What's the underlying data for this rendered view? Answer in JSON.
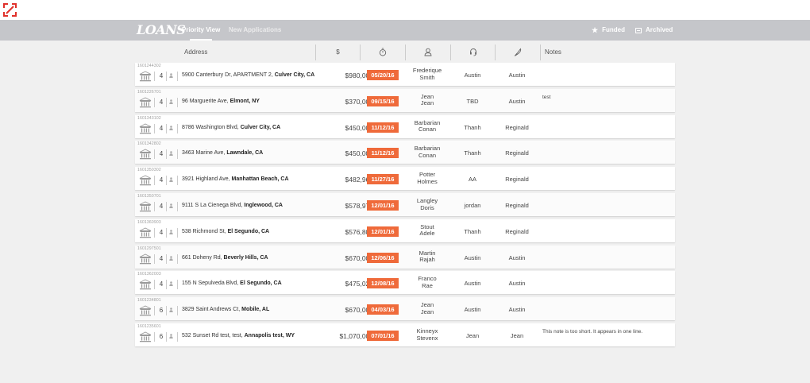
{
  "app": {
    "brand": "LOANS"
  },
  "nav": {
    "tabs": [
      {
        "label": "Priority View",
        "active": true
      },
      {
        "label": "New Applications",
        "active": false
      }
    ],
    "right": [
      {
        "label": "Funded",
        "icon": "star-icon"
      },
      {
        "label": "Archived",
        "icon": "archive-icon"
      }
    ]
  },
  "columns": {
    "address": "Address",
    "amount": "$",
    "deadline_icon": "stopwatch-icon",
    "client_icon": "person-icon",
    "officer_icon": "headset-icon",
    "processor_icon": "feather-icon",
    "notes": "Notes"
  },
  "colors": {
    "accent": "#ef6a3a",
    "navbar": "#c5c6ca"
  },
  "rows": [
    {
      "id": "1601244302",
      "count": "4",
      "street": "5900 Canterbury Dr, APARTMENT 2, ",
      "city": "Culver City, CA",
      "amount": "$980,000",
      "date": "05/20/16",
      "client_first": "Frederique",
      "client_last": "Smith",
      "officer": "Austin",
      "processor": "Austin",
      "note": ""
    },
    {
      "id": "1601226701",
      "count": "4",
      "street": "96 Marguerite Ave, ",
      "city": "Elmont, NY",
      "amount": "$370,000",
      "date": "09/15/16",
      "client_first": "Jean",
      "client_last": "Jean",
      "officer": "TBD",
      "processor": "Austin",
      "note": "test"
    },
    {
      "id": "1601343102",
      "count": "4",
      "street": "8786 Washington Blvd, ",
      "city": "Culver City, CA",
      "amount": "$450,000",
      "date": "11/12/16",
      "client_first": "Barbarian",
      "client_last": "Conan",
      "officer": "Thanh",
      "processor": "Reginald",
      "note": ""
    },
    {
      "id": "1601342802",
      "count": "4",
      "street": "3463 Marine Ave, ",
      "city": "Lawndale, CA",
      "amount": "$450,000",
      "date": "11/12/16",
      "client_first": "Barbarian",
      "client_last": "Conan",
      "officer": "Thanh",
      "processor": "Reginald",
      "note": ""
    },
    {
      "id": "1601350302",
      "count": "4",
      "street": "3921 Highland Ave, ",
      "city": "Manhattan Beach, CA",
      "amount": "$482,962",
      "date": "11/27/16",
      "client_first": "Potter",
      "client_last": "Holmes",
      "officer": "AA",
      "processor": "Reginald",
      "note": ""
    },
    {
      "id": "1601350701",
      "count": "4",
      "street": "9111 S La Cienega Blvd, ",
      "city": "Inglewood, CA",
      "amount": "$578,978",
      "date": "12/01/16",
      "client_first": "Langley",
      "client_last": "Doris",
      "officer": "jordan",
      "processor": "Reginald",
      "note": ""
    },
    {
      "id": "1601360903",
      "count": "4",
      "street": "538 Richmond St, ",
      "city": "El Segundo, CA",
      "amount": "$576,804",
      "date": "12/01/16",
      "client_first": "Stout",
      "client_last": "Adele",
      "officer": "Thanh",
      "processor": "Reginald",
      "note": ""
    },
    {
      "id": "1601297501",
      "count": "4",
      "street": "661 Doheny Rd, ",
      "city": "Beverly Hills, CA",
      "amount": "$670,000",
      "date": "12/06/16",
      "client_first": "Martin",
      "client_last": "Rajah",
      "officer": "Austin",
      "processor": "Austin",
      "note": ""
    },
    {
      "id": "1601362003",
      "count": "4",
      "street": "155 N Sepulveda Blvd, ",
      "city": "El Segundo, CA",
      "amount": "$475,023",
      "date": "12/08/16",
      "client_first": "Franco",
      "client_last": "Rae",
      "officer": "Austin",
      "processor": "Austin",
      "note": ""
    },
    {
      "id": "1601234801",
      "count": "6",
      "street": "3829 Saint Andrews Ct, ",
      "city": "Mobile, AL",
      "amount": "$670,000",
      "date": "04/03/16",
      "client_first": "Jean",
      "client_last": "Jean",
      "officer": "Austin",
      "processor": "Austin",
      "note": ""
    },
    {
      "id": "1601235601",
      "count": "6",
      "street": "532 Sunset Rd test, test, ",
      "city": "Annapolis test, WY",
      "amount": "$1,070,000",
      "date": "07/01/16",
      "client_first": "Kinneyx",
      "client_last": "Stevenx",
      "officer": "Jean",
      "processor": "Jean",
      "note": "This note is too short. It appears in one line."
    }
  ]
}
